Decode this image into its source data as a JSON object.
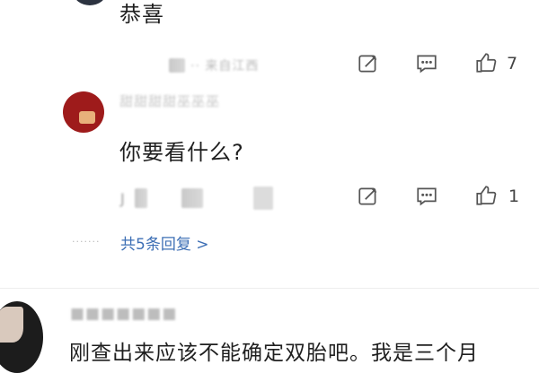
{
  "comment1": {
    "text": "恭喜",
    "meta": "·· 来自江西",
    "like_count": "7",
    "icons": [
      "edit-icon",
      "reply-icon",
      "thumbs-up-icon"
    ]
  },
  "comment2": {
    "username": "甜甜甜甜巫巫巫",
    "text": "你要看什么?",
    "meta": "J",
    "like_count": "1"
  },
  "more_replies": {
    "dots": "·······",
    "label": "共5条回复 >"
  },
  "comment3": {
    "username": "■■■■■■■",
    "text": "刚查出来应该不能确定双胎吧。我是三个月"
  }
}
